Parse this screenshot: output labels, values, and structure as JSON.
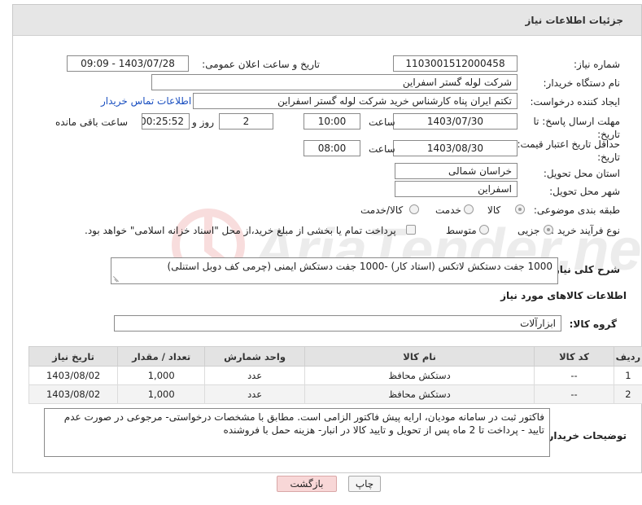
{
  "header": {
    "title": "جزئیات اطلاعات نیاز"
  },
  "need_number": {
    "label": "شماره نیاز:",
    "value": "1103001512000458"
  },
  "announce_date": {
    "label": "تاریخ و ساعت اعلان عمومی:",
    "value": "1403/07/28 - 09:09"
  },
  "buyer_org": {
    "label": "نام دستگاه خریدار:",
    "value": "شرکت لوله گستر اسفراین"
  },
  "requester": {
    "label": "ایجاد کننده درخواست:",
    "value": "تکتم ایران پناه کارشناس خرید شرکت لوله گستر اسفراین",
    "contact_link": "اطلاعات تماس خریدار"
  },
  "reply_deadline": {
    "label": "مهلت ارسال پاسخ: تا تاریخ:",
    "date": "1403/07/30",
    "time_label": "ساعت",
    "time": "10:00",
    "days": "2",
    "days_label": "روز و",
    "remaining": "00:25:52",
    "remaining_label": "ساعت باقی مانده"
  },
  "price_validity": {
    "label": "حداقل تاریخ اعتبار قیمت: تا تاریخ:",
    "date": "1403/08/30",
    "time_label": "ساعت",
    "time": "08:00"
  },
  "province": {
    "label": "استان محل تحویل:",
    "value": "خراسان شمالی"
  },
  "city": {
    "label": "شهر محل تحویل:",
    "value": "اسفراین"
  },
  "category": {
    "label": "طبقه بندی موضوعی:",
    "options": [
      "کالا",
      "خدمت",
      "کالا/خدمت"
    ],
    "selected": "کالا"
  },
  "purchase_type": {
    "label": "نوع فرآیند خرید :",
    "options": [
      "جزیی",
      "متوسط"
    ],
    "selected": "جزیی",
    "payment_note": "پرداخت تمام یا بخشی از مبلغ خرید،از محل \"اسناد خزانه اسلامی\" خواهد بود."
  },
  "description": {
    "label": "شرح کلی نیاز:",
    "value": "1000 جفت دستکش لاتکس (استاد کار) -1000 جفت دستکش ایمنی (چرمی کف دوبل استنلی)"
  },
  "goods_section": {
    "title": "اطلاعات کالاهای مورد نیاز"
  },
  "goods_group": {
    "label": "گروه کالا:",
    "value": "ابزارآلات"
  },
  "table": {
    "headers": [
      "ردیف",
      "کد کالا",
      "نام کالا",
      "واحد شمارش",
      "تعداد / مقدار",
      "تاریخ نیاز"
    ],
    "rows": [
      [
        "1",
        "--",
        "دستکش محافظ",
        "عدد",
        "1,000",
        "1403/08/02"
      ],
      [
        "2",
        "--",
        "دستکش محافظ",
        "عدد",
        "1,000",
        "1403/08/02"
      ]
    ]
  },
  "buyer_notes": {
    "label": "توضیحات خریدار:",
    "value": "فاکتور ثبت در سامانه مودیان، ارایه پیش فاکتور الزامی است. مطابق با مشخصات درخواستی- مرجوعی در صورت عدم تایید - پرداخت تا 2 ماه پس از تحویل و تایید کالا در انبار- هزینه حمل با فروشنده"
  },
  "buttons": {
    "print": "چاپ",
    "back": "بازگشت"
  },
  "watermark": {
    "text": "AriaTender.net"
  },
  "colors": {
    "link": "#1a4fc0",
    "header_bg": "#e6e6e6",
    "back_button_bg": "#f8d7d7"
  }
}
